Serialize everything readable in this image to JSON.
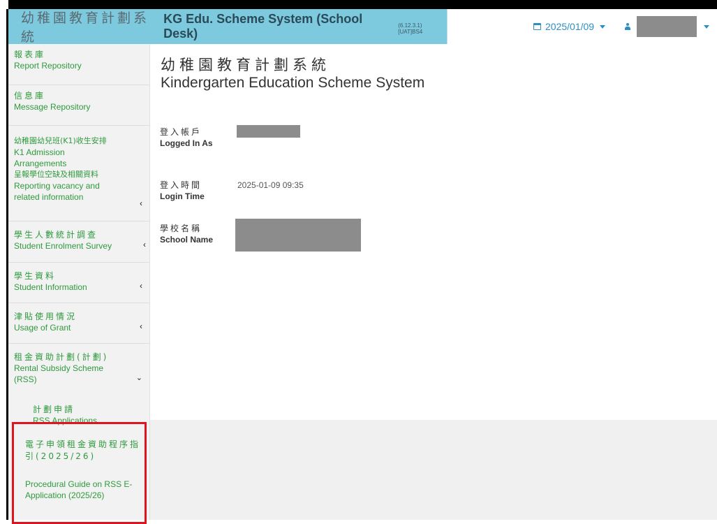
{
  "header": {
    "title_zh": "幼稚園教育計劃系統",
    "title_en": "KG Edu. Scheme System (School Desk)",
    "version": "(6.12.3.1) [UAT]BS4",
    "date": "2025/01/09",
    "brand_color": "#7dc9de",
    "accent_color": "#2b8fc7"
  },
  "sidebar": {
    "items": [
      {
        "zh": "報表庫",
        "en": "Report Repository",
        "chevron": ""
      },
      {
        "zh": "信息庫",
        "en": "Message Repository",
        "chevron": ""
      },
      {
        "zh": "幼稚園幼兒班(K1)收生安排",
        "en": "K1 Admission Arrangements",
        "zh2": "呈報學位空缺及相關資料",
        "en2": "Reporting vacancy and related information",
        "chevron": "‹"
      },
      {
        "zh": "學生人數統計調查",
        "en": "Student Enrolment Survey",
        "chevron": "‹"
      },
      {
        "zh": "學生資料",
        "en": "Student Information",
        "chevron": "‹"
      },
      {
        "zh": "津貼使用情況",
        "en": "Usage of Grant",
        "chevron": "‹"
      },
      {
        "zh": "租金資助計劃(計劃)",
        "en": "Rental Subsidy Scheme (RSS)",
        "chevron": "⌄"
      }
    ],
    "sub_items": [
      {
        "zh": "計劃申請",
        "en": "RSS Applications"
      }
    ],
    "guide": {
      "zh": "電子申領租金資助程序指引(2025/26)",
      "en": "Procedural Guide on RSS E-Application (2025/26)"
    },
    "link_color": "#2e9a3d",
    "highlight_color": "#e0141e"
  },
  "main": {
    "title_zh": "幼稚園教育計劃系統",
    "title_en": "Kindergarten Education Scheme System",
    "login_account_label_zh": "登入帳戶",
    "login_account_label_en": "Logged In As",
    "login_time_label_zh": "登入時間",
    "login_time_label_en": "Login Time",
    "login_time_value": "2025-01-09 09:35",
    "school_name_label_zh": "學校名稱",
    "school_name_label_en": "School Name"
  }
}
